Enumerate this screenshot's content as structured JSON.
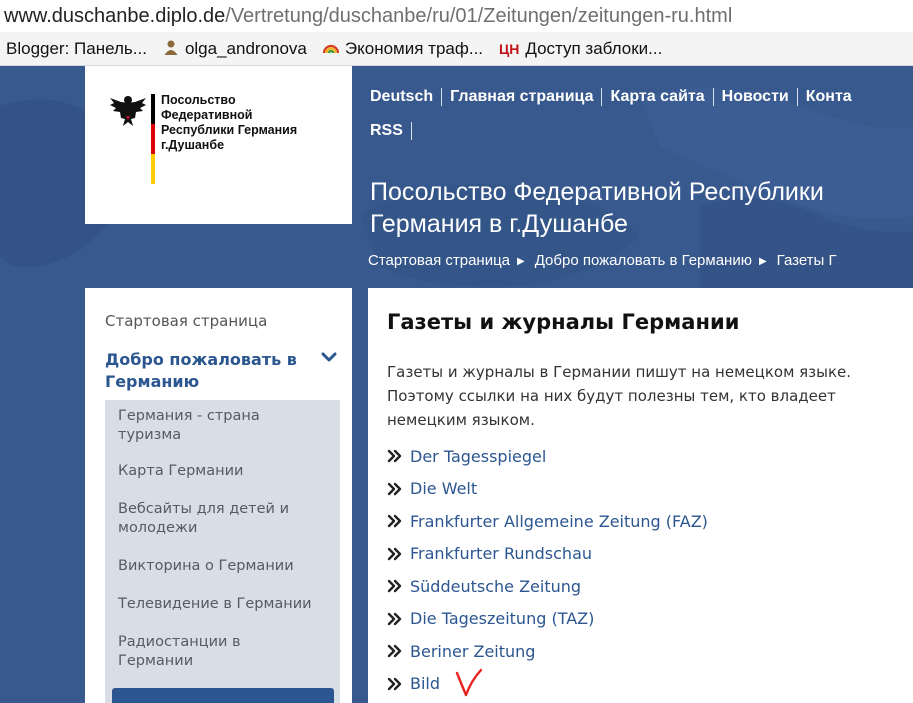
{
  "browser": {
    "url_host": "www.duschanbe.diplo.de",
    "url_path": "/Vertretung/duschanbe/ru/01/Zeitungen/zeitungen-ru.html",
    "bookmarks": [
      {
        "label": "Blogger: Панель..."
      },
      {
        "label": "olga_andronova",
        "icon": "person-icon"
      },
      {
        "label": "Экономия траф...",
        "icon": "rainbow-icon"
      },
      {
        "label": "Доступ заблоки...",
        "icon_text": "ЦН"
      }
    ]
  },
  "header": {
    "logo_lines": [
      "Посольство",
      "Федеративной",
      "Республики Германия",
      "г.Душанбе"
    ],
    "nav_row1": [
      "Deutsch",
      "Главная страница",
      "Карта сайта",
      "Новости",
      "Конта"
    ],
    "nav_row2": [
      "RSS"
    ],
    "site_title": "Посольство Федеративной Республики Германия в г.Душанбе",
    "breadcrumb": [
      "Стартовая страница",
      "Добро пожаловать в Германию",
      "Газеты Г"
    ],
    "flag_colors": [
      "#000000",
      "#dd0000",
      "#ffcc00"
    ]
  },
  "sidebar": {
    "home": "Стартовая страница",
    "section": "Добро пожаловать в Германию",
    "items": [
      "Германия - страна туризма",
      "Карта Германии",
      "Вебсайты для детей и молодежи",
      "Викторина о Германии",
      "Телевидение в Германии",
      "Радиостанции в Германии"
    ]
  },
  "main": {
    "title": "Газеты и журналы Германии",
    "intro": "Газеты и журналы в Германии пишут на немецком языке. Поэтому ссылки на них будут полезны тем, кто владеет немецким языком.",
    "links": [
      "Der Tagesspiegel",
      "Die Welt",
      "Frankfurter Allgemeine Zeitung (FAZ)",
      "Frankfurter Rundschau",
      "Süddeutsche Zeitung",
      "Die Tageszeitung (TAZ)",
      "Beriner Zeitung",
      "Bild"
    ]
  },
  "colors": {
    "brand_blue": "#2b5690",
    "header_bg": "#38598d",
    "sidebar_sub_bg": "#d9dde6",
    "annotation_red": "#e8231f"
  }
}
